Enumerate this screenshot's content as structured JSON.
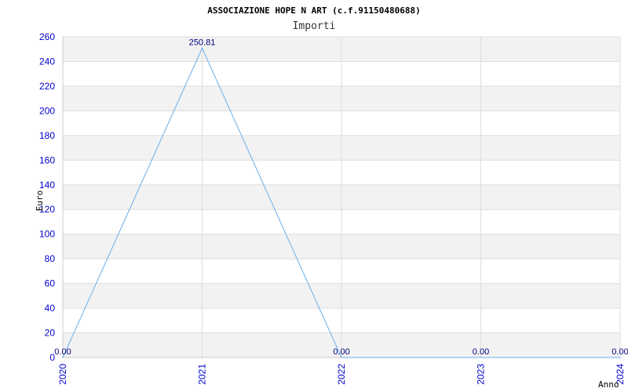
{
  "chart_data": {
    "type": "line",
    "title": "ASSOCIAZIONE HOPE N ART (c.f.91150480688)",
    "subtitle": "Importi",
    "xlabel": "Anno",
    "ylabel": "Euro",
    "x": [
      "2020",
      "2021",
      "2022",
      "2023",
      "2024"
    ],
    "series": [
      {
        "values": [
          0,
          250.81,
          0,
          0,
          0
        ]
      }
    ],
    "data_labels": [
      "0.00",
      "250.81",
      "0.00",
      "0.00",
      "0.00"
    ],
    "ylim": [
      0,
      260
    ],
    "yticks": [
      0,
      20,
      40,
      60,
      80,
      100,
      120,
      140,
      160,
      180,
      200,
      220,
      240,
      260
    ],
    "grid": true,
    "colors": {
      "line": "#6aaee8",
      "tick_text": "#0000cc",
      "data_label": "#000080",
      "band": "#f2f2f2",
      "grid": "#dddddd",
      "axis": "#cccccc"
    }
  }
}
